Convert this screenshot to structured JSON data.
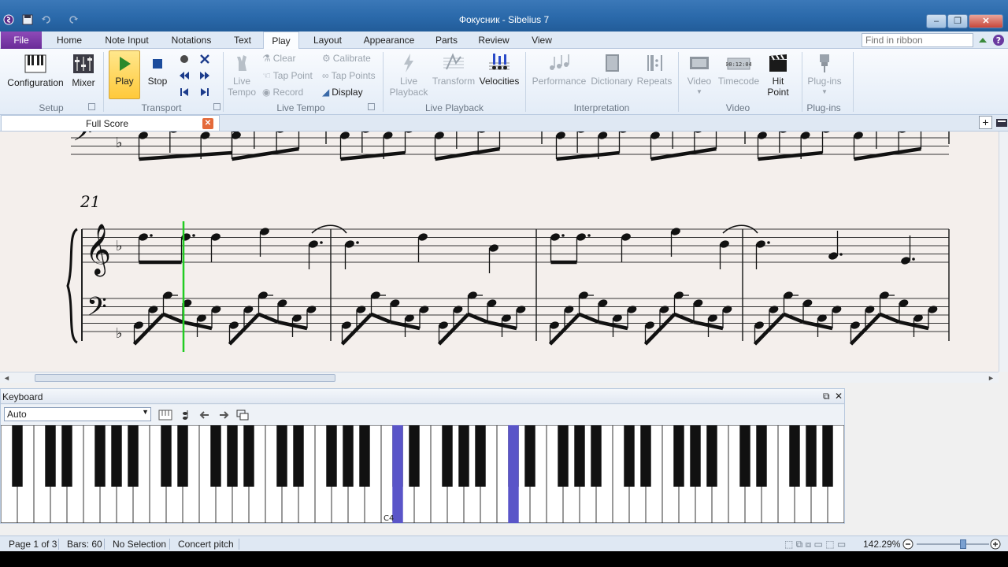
{
  "window": {
    "title": "Фокусник - Sibelius 7"
  },
  "ribbon_tabs": [
    "File",
    "Home",
    "Note Input",
    "Notations",
    "Text",
    "Play",
    "Layout",
    "Appearance",
    "Parts",
    "Review",
    "View"
  ],
  "active_tab": "Play",
  "search": {
    "placeholder": "Find in ribbon"
  },
  "setup": {
    "configuration": "Configuration",
    "mixer": "Mixer",
    "group": "Setup"
  },
  "transport": {
    "play": "Play",
    "stop": "Stop",
    "group": "Transport"
  },
  "live_tempo": {
    "live_tempo_line1": "Live",
    "live_tempo_line2": "Tempo",
    "clear": "Clear",
    "tap_point": "Tap Point",
    "record": "Record",
    "calibrate": "Calibrate",
    "tap_points": "Tap Points",
    "display": "Display",
    "group": "Live Tempo"
  },
  "live_playback": {
    "live_playback_line1": "Live",
    "live_playback_line2": "Playback",
    "transform": "Transform",
    "velocities": "Velocities",
    "group": "Live Playback"
  },
  "interpretation": {
    "performance": "Performance",
    "dictionary": "Dictionary",
    "repeats": "Repeats",
    "group": "Interpretation"
  },
  "video": {
    "video": "Video",
    "timecode": "Timecode",
    "timecode_display": "00:12:04",
    "hit_point_line1": "Hit",
    "hit_point_line2": "Point",
    "group": "Video"
  },
  "plugins": {
    "plugins": "Plug-ins",
    "group": "Plug-ins"
  },
  "score_tab": {
    "label": "Full Score"
  },
  "score": {
    "bar_number": "21"
  },
  "keyboard": {
    "title": "Keyboard",
    "mode": "Auto",
    "c4_label": "C4",
    "white_key_count": 51,
    "highlight_color": "#5a55c8"
  },
  "status": {
    "page": "Page 1 of 3",
    "bars": "Bars: 60",
    "selection": "No Selection",
    "pitch": "Concert pitch",
    "zoom": "142.29%"
  },
  "colors": {
    "playline": "#22cc22",
    "file_tab": "#7a38a8",
    "title_bar": "#2a69aa"
  }
}
